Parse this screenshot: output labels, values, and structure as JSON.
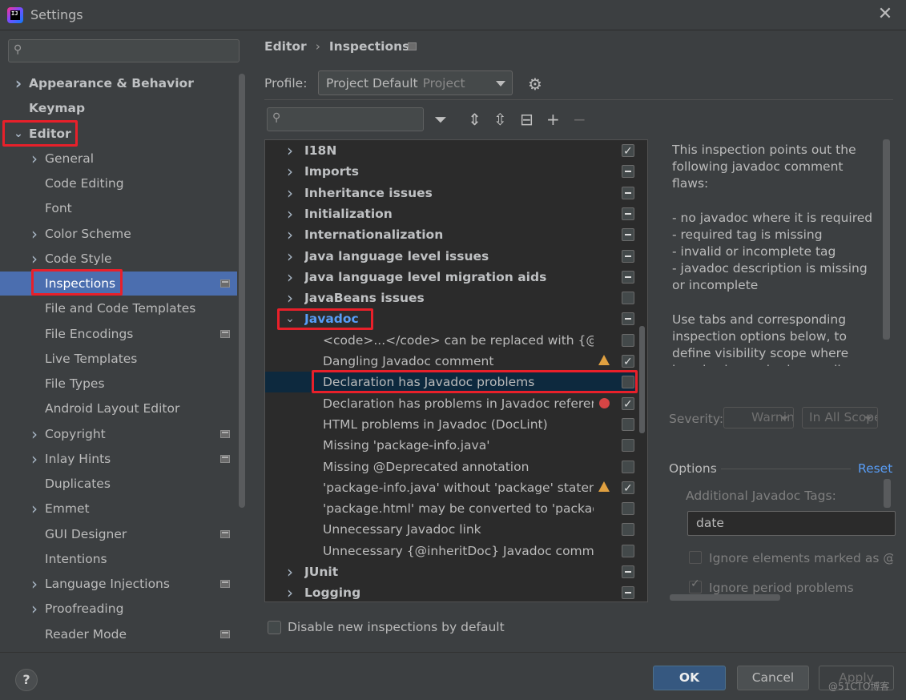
{
  "window": {
    "title": "Settings",
    "app_icon_text": "IJ"
  },
  "sidebar": {
    "search_placeholder": "",
    "items": [
      {
        "label": "Appearance & Behavior",
        "bold": true,
        "chevron": "right",
        "indent": 0
      },
      {
        "label": "Keymap",
        "bold": true,
        "chevron": "",
        "indent": 0
      },
      {
        "label": "Editor",
        "bold": true,
        "chevron": "down",
        "indent": 0
      },
      {
        "label": "General",
        "chevron": "right",
        "indent": 1
      },
      {
        "label": "Code Editing",
        "chevron": "",
        "indent": 1
      },
      {
        "label": "Font",
        "chevron": "",
        "indent": 1
      },
      {
        "label": "Color Scheme",
        "chevron": "right",
        "indent": 1
      },
      {
        "label": "Code Style",
        "chevron": "right",
        "indent": 1
      },
      {
        "label": "Inspections",
        "chevron": "",
        "indent": 1,
        "selected": true,
        "project_icon": true
      },
      {
        "label": "File and Code Templates",
        "chevron": "",
        "indent": 1
      },
      {
        "label": "File Encodings",
        "chevron": "",
        "indent": 1,
        "project_icon": true
      },
      {
        "label": "Live Templates",
        "chevron": "",
        "indent": 1
      },
      {
        "label": "File Types",
        "chevron": "",
        "indent": 1
      },
      {
        "label": "Android Layout Editor",
        "chevron": "",
        "indent": 1
      },
      {
        "label": "Copyright",
        "chevron": "right",
        "indent": 1,
        "project_icon": true
      },
      {
        "label": "Inlay Hints",
        "chevron": "right",
        "indent": 1,
        "project_icon": true
      },
      {
        "label": "Duplicates",
        "chevron": "",
        "indent": 1
      },
      {
        "label": "Emmet",
        "chevron": "right",
        "indent": 1
      },
      {
        "label": "GUI Designer",
        "chevron": "",
        "indent": 1,
        "project_icon": true
      },
      {
        "label": "Intentions",
        "chevron": "",
        "indent": 1
      },
      {
        "label": "Language Injections",
        "chevron": "right",
        "indent": 1,
        "project_icon": true
      },
      {
        "label": "Proofreading",
        "chevron": "right",
        "indent": 1
      },
      {
        "label": "Reader Mode",
        "chevron": "",
        "indent": 1,
        "project_icon": true
      }
    ]
  },
  "breadcrumb": {
    "first": "Editor",
    "separator": "›",
    "second": "Inspections"
  },
  "profile": {
    "label": "Profile:",
    "value": "Project Default",
    "scope": "Project"
  },
  "inspections": {
    "search_placeholder": "",
    "rows": [
      {
        "label": "I18N",
        "group": true,
        "chevron": "right",
        "check": "checked"
      },
      {
        "label": "Imports",
        "group": true,
        "chevron": "right",
        "check": "mixed"
      },
      {
        "label": "Inheritance issues",
        "group": true,
        "chevron": "right",
        "check": "mixed"
      },
      {
        "label": "Initialization",
        "group": true,
        "chevron": "right",
        "check": "mixed"
      },
      {
        "label": "Internationalization",
        "group": true,
        "chevron": "right",
        "check": "mixed"
      },
      {
        "label": "Java language level issues",
        "group": true,
        "chevron": "right",
        "check": "mixed"
      },
      {
        "label": "Java language level migration aids",
        "group": true,
        "chevron": "right",
        "check": "mixed"
      },
      {
        "label": "JavaBeans issues",
        "group": true,
        "chevron": "right",
        "check": "none"
      },
      {
        "label": "Javadoc",
        "group": true,
        "chevron": "down",
        "check": "mixed",
        "blue": true
      },
      {
        "label": "<code>...</code> can be replaced with {@code ...}",
        "group": false,
        "check": "none"
      },
      {
        "label": "Dangling Javadoc comment",
        "group": false,
        "check": "checked",
        "severity": "warning"
      },
      {
        "label": "Declaration has Javadoc problems",
        "group": false,
        "check": "none",
        "highlighted": true
      },
      {
        "label": "Declaration has problems in Javadoc references",
        "group": false,
        "check": "checked",
        "severity": "error"
      },
      {
        "label": "HTML problems in Javadoc (DocLint)",
        "group": false,
        "check": "none"
      },
      {
        "label": "Missing 'package-info.java'",
        "group": false,
        "check": "none"
      },
      {
        "label": "Missing @Deprecated annotation",
        "group": false,
        "check": "none"
      },
      {
        "label": "'package-info.java' without 'package' statement",
        "group": false,
        "check": "checked",
        "severity": "warning"
      },
      {
        "label": "'package.html' may be converted to 'package-info.java'",
        "group": false,
        "check": "none"
      },
      {
        "label": "Unnecessary Javadoc link",
        "group": false,
        "check": "none"
      },
      {
        "label": "Unnecessary {@inheritDoc} Javadoc comment",
        "group": false,
        "check": "none"
      },
      {
        "label": "JUnit",
        "group": true,
        "chevron": "right",
        "check": "mixed"
      },
      {
        "label": "Logging",
        "group": true,
        "chevron": "right",
        "check": "mixed"
      }
    ]
  },
  "description": {
    "p1": "This inspection points out the following javadoc comment flaws:",
    "p2": "- no javadoc where it is required\n- required tag is missing\n- invalid or incomplete tag\n- javadoc description is missing or incomplete",
    "p3": "Use tabs and corresponding inspection options below, to define visibility scope where javadoc is required, as well as the required tags each scope of"
  },
  "severity": {
    "label": "Severity:",
    "value": "Warning",
    "scope": "In All Scopes"
  },
  "options": {
    "label": "Options",
    "reset": "Reset",
    "additional_tags_label": "Additional Javadoc Tags:",
    "additional_tags_value": "date",
    "ignore_deprecated": "Ignore elements marked as @deprecated",
    "ignore_period": "Ignore period problems"
  },
  "disable_new": "Disable new inspections by default",
  "buttons": {
    "help": "?",
    "ok": "OK",
    "cancel": "Cancel",
    "apply": "Apply"
  },
  "watermark": "@51CTO博客",
  "colors": {
    "selection": "#4b6eaf",
    "link": "#589df6",
    "annotation": "#e8202a",
    "ok_button": "#365880"
  }
}
